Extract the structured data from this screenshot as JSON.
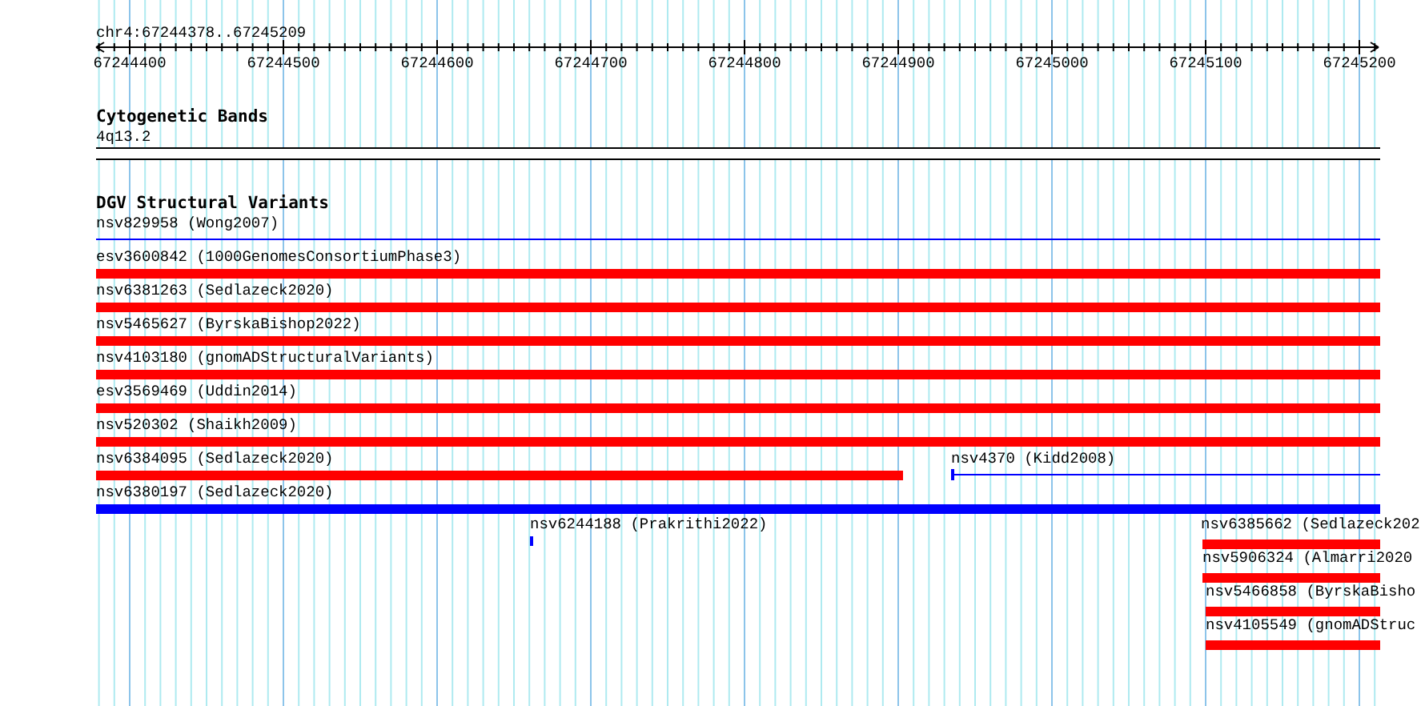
{
  "region": {
    "title": "chr4:67244378..67245209"
  },
  "ruler": {
    "ticks": [
      "67244400",
      "67244500",
      "67244600",
      "67244700",
      "67244800",
      "67244900",
      "67245000",
      "67245100",
      "67245200"
    ]
  },
  "cytogenetic_bands": {
    "title": "Cytogenetic Bands",
    "band": "4q13.2"
  },
  "structural_variants": {
    "title": "DGV Structural Variants",
    "features": [
      {
        "label": "nsv829958 (Wong2007)",
        "kind": "line",
        "color": "#0000ff"
      },
      {
        "label": "esv3600842 (1000GenomesConsortiumPhase3)",
        "kind": "bar",
        "color": "#ff0000"
      },
      {
        "label": "nsv6381263 (Sedlazeck2020)",
        "kind": "bar",
        "color": "#ff0000"
      },
      {
        "label": "nsv5465627 (ByrskaBishop2022)",
        "kind": "bar",
        "color": "#ff0000"
      },
      {
        "label": "nsv4103180 (gnomADStructuralVariants)",
        "kind": "bar",
        "color": "#ff0000"
      },
      {
        "label": "esv3569469 (Uddin2014)",
        "kind": "bar",
        "color": "#ff0000"
      },
      {
        "label": "nsv520302 (Shaikh2009)",
        "kind": "bar",
        "color": "#ff0000"
      },
      {
        "label": "nsv6384095 (Sedlazeck2020)",
        "kind": "bar",
        "color": "#ff0000"
      },
      {
        "label": "nsv4370 (Kidd2008)",
        "kind": "line",
        "color": "#0000ff"
      },
      {
        "label": "nsv6380197 (Sedlazeck2020)",
        "kind": "bar",
        "color": "#0000ff"
      },
      {
        "label": "nsv6244188 (Prakrithi2022)",
        "kind": "bar",
        "color": "#0000ff"
      },
      {
        "label": "nsv6385662 (Sedlazeck202",
        "kind": "bar",
        "color": "#ff0000"
      },
      {
        "label": "nsv5906324 (Almarri2020",
        "kind": "bar",
        "color": "#ff0000"
      },
      {
        "label": "nsv5466858 (ByrskaBisho",
        "kind": "bar",
        "color": "#ff0000"
      },
      {
        "label": "nsv4105549 (gnomADStruc",
        "kind": "bar",
        "color": "#ff0000"
      }
    ]
  }
}
